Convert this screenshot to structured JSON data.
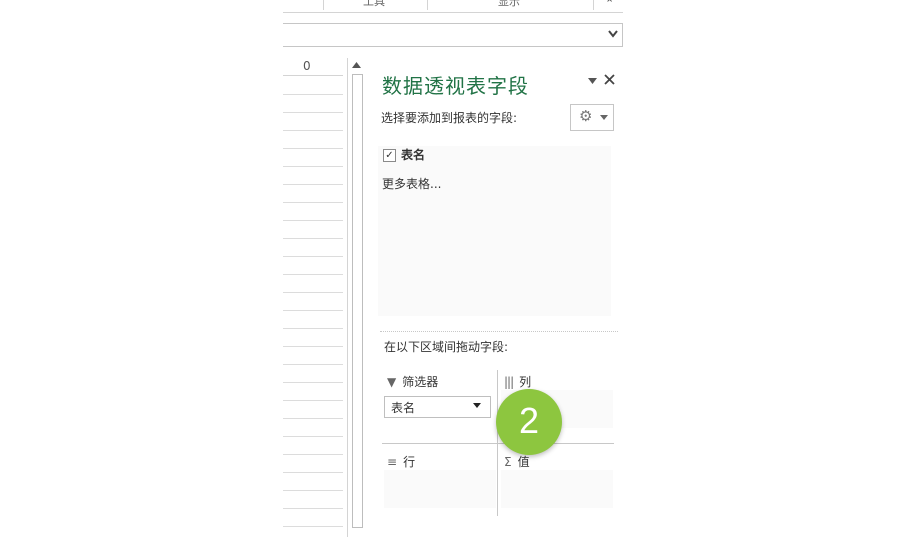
{
  "ribbon": {
    "group_left": "工具",
    "group_right": "显示"
  },
  "grid": {
    "column_header": "0"
  },
  "pane": {
    "title": "数据透视表字段",
    "choose_label": "选择要添加到报表的字段:",
    "fields": [
      {
        "name": "表名",
        "checked": true
      }
    ],
    "more_tables": "更多表格...",
    "drag_label": "在以下区域间拖动字段:",
    "areas": {
      "filter": {
        "label": "筛选器",
        "icon": "filter-icon",
        "item": "表名"
      },
      "columns": {
        "label": "列",
        "icon": "columns-icon"
      },
      "rows": {
        "label": "行",
        "icon": "rows-icon"
      },
      "values": {
        "label": "值",
        "icon": "sigma-icon"
      }
    }
  },
  "badge": {
    "number": "2"
  },
  "colors": {
    "title": "#217346",
    "badge": "#8dc63f"
  }
}
